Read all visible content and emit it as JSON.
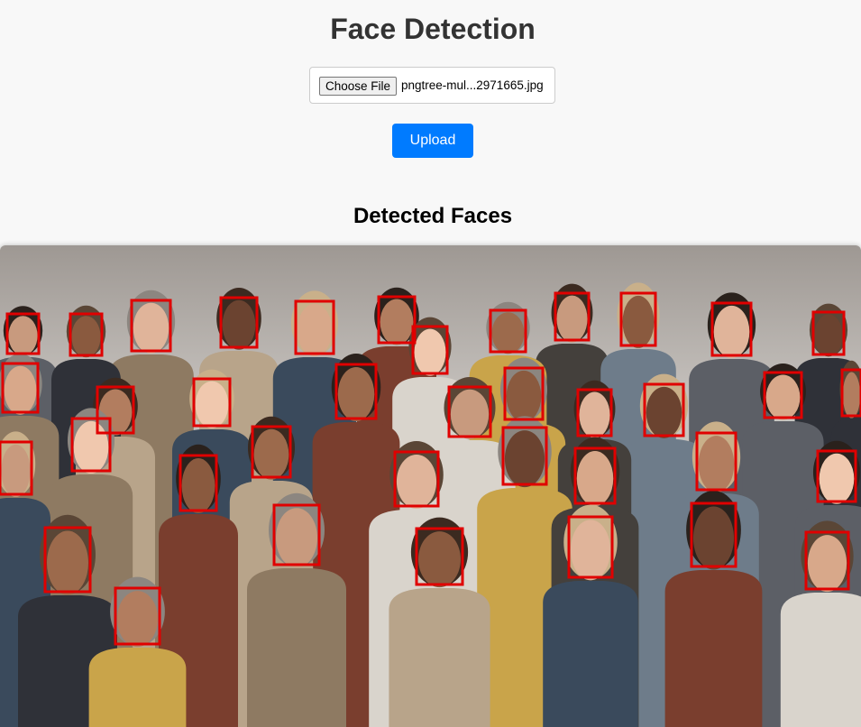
{
  "header": {
    "title": "Face Detection"
  },
  "upload_form": {
    "choose_file_label": "Choose File",
    "file_name": "pngtree-mul...2971665.jpg",
    "upload_label": "Upload"
  },
  "results": {
    "heading": "Detected Faces",
    "image_alt": "group photo of people with detected faces outlined",
    "box_color": "#e00000",
    "face_count": 41
  },
  "colors": {
    "accent": "#007bff",
    "title": "#333333",
    "background": "#f8f8f8"
  }
}
